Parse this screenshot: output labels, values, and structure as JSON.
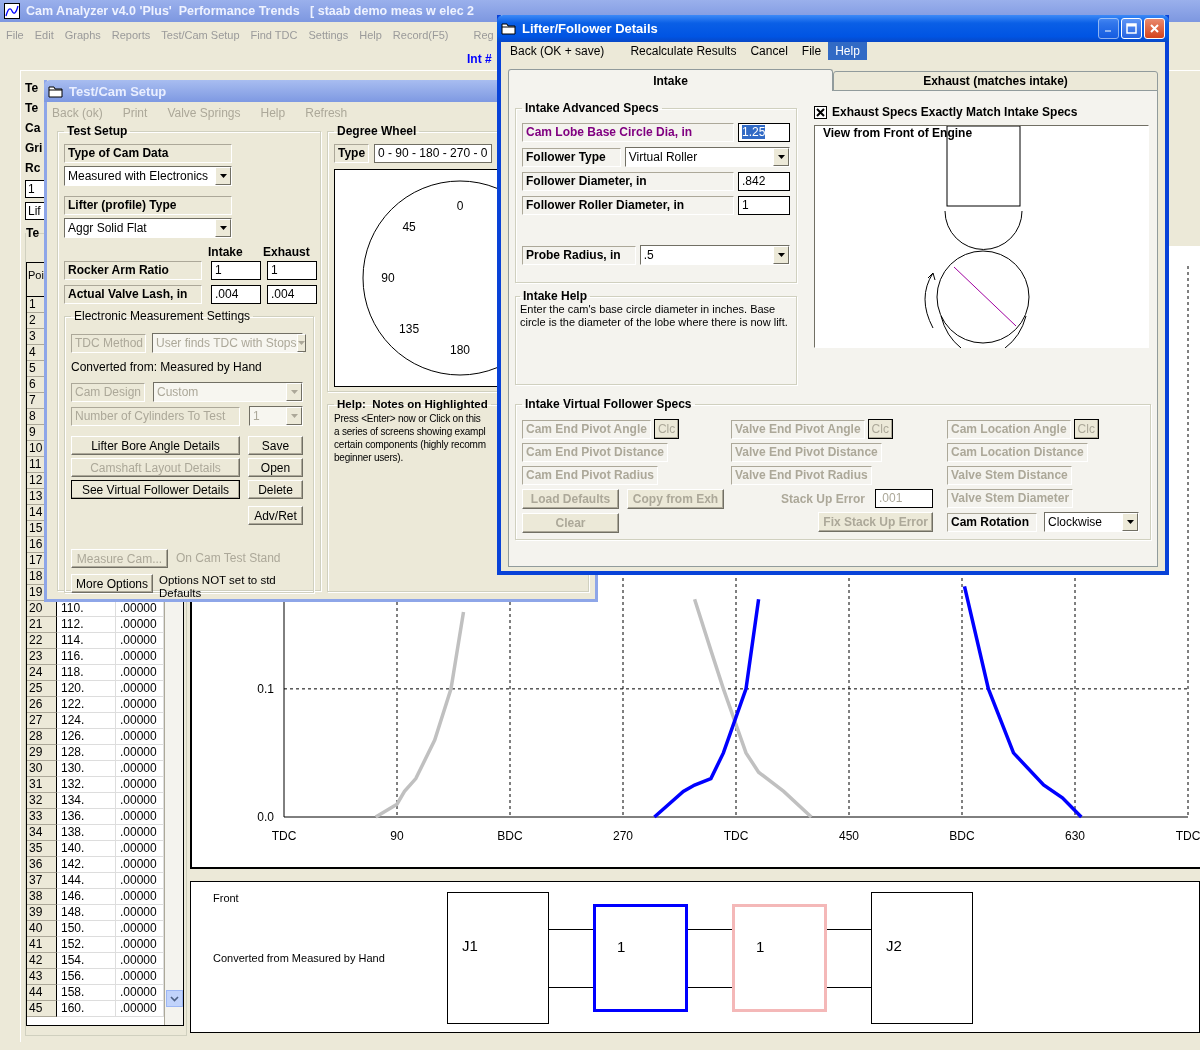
{
  "main": {
    "title": "Cam Analyzer v4.0 'Plus'  Performance Trends   [ staab demo meas w elec 2",
    "menu": [
      "File",
      "Edit",
      "Graphs",
      "Reports",
      "Test/Cam Setup",
      "Find TDC",
      "Settings",
      "Help",
      "Record(F5)",
      "Reg"
    ],
    "int_label": "Int #"
  },
  "left_panel": {
    "fragments": [
      {
        "kind": "label",
        "text": "Te"
      },
      {
        "kind": "label",
        "text": "Te"
      },
      {
        "kind": "label",
        "text": "Ca"
      },
      {
        "kind": "label",
        "text": "Gri"
      },
      {
        "kind": "label",
        "text": "Rc"
      },
      {
        "kind": "input",
        "text": "1"
      },
      {
        "kind": "input",
        "text": "Lif"
      }
    ],
    "table_group": "Te",
    "table": {
      "header": "Poi",
      "rows": [
        {
          "num": "1"
        },
        {
          "num": "2"
        },
        {
          "num": "3"
        },
        {
          "num": "4"
        },
        {
          "num": "5"
        },
        {
          "num": "6"
        },
        {
          "num": "7"
        },
        {
          "num": "8"
        },
        {
          "num": "9"
        },
        {
          "num": "10"
        },
        {
          "num": "11"
        },
        {
          "num": "12"
        },
        {
          "num": "13"
        },
        {
          "num": "14"
        },
        {
          "num": "15"
        },
        {
          "num": "16"
        },
        {
          "num": "17"
        },
        {
          "num": "18"
        },
        {
          "num": "19"
        },
        {
          "num": "20",
          "deg": "110.",
          "lift": ".00000"
        },
        {
          "num": "21",
          "deg": "112.",
          "lift": ".00000"
        },
        {
          "num": "22",
          "deg": "114.",
          "lift": ".00000"
        },
        {
          "num": "23",
          "deg": "116.",
          "lift": ".00000"
        },
        {
          "num": "24",
          "deg": "118.",
          "lift": ".00000"
        },
        {
          "num": "25",
          "deg": "120.",
          "lift": ".00000"
        },
        {
          "num": "26",
          "deg": "122.",
          "lift": ".00000"
        },
        {
          "num": "27",
          "deg": "124.",
          "lift": ".00000"
        },
        {
          "num": "28",
          "deg": "126.",
          "lift": ".00000"
        },
        {
          "num": "29",
          "deg": "128.",
          "lift": ".00000"
        },
        {
          "num": "30",
          "deg": "130.",
          "lift": ".00000"
        },
        {
          "num": "31",
          "deg": "132.",
          "lift": ".00000"
        },
        {
          "num": "32",
          "deg": "134.",
          "lift": ".00000"
        },
        {
          "num": "33",
          "deg": "136.",
          "lift": ".00000"
        },
        {
          "num": "34",
          "deg": "138.",
          "lift": ".00000"
        },
        {
          "num": "35",
          "deg": "140.",
          "lift": ".00000"
        },
        {
          "num": "36",
          "deg": "142.",
          "lift": ".00000"
        },
        {
          "num": "37",
          "deg": "144.",
          "lift": ".00000"
        },
        {
          "num": "38",
          "deg": "146.",
          "lift": ".00000"
        },
        {
          "num": "39",
          "deg": "148.",
          "lift": ".00000"
        },
        {
          "num": "40",
          "deg": "150.",
          "lift": ".00000"
        },
        {
          "num": "41",
          "deg": "152.",
          "lift": ".00000"
        },
        {
          "num": "42",
          "deg": "154.",
          "lift": ".00000"
        },
        {
          "num": "43",
          "deg": "156.",
          "lift": ".00000"
        },
        {
          "num": "44",
          "deg": "158.",
          "lift": ".00000"
        },
        {
          "num": "45",
          "deg": "160.",
          "lift": ".00000"
        }
      ]
    }
  },
  "lift_chart": {
    "chart_data": {
      "type": "line",
      "x": [
        73,
        90,
        96,
        105,
        120,
        133,
        143,
        295,
        318,
        327,
        340,
        350,
        368,
        378,
        398,
        420,
        542,
        561,
        581,
        605,
        620,
        635
      ],
      "series": [
        {
          "color": "#c0c0c0",
          "values": [
            0,
            0.01,
            0.02,
            0.03,
            0.06,
            0.1,
            0.16,
            null,
            null,
            0.17,
            0.13,
            0.1,
            0.05,
            0.035,
            0.02,
            0,
            null,
            null,
            null,
            null,
            null,
            null
          ]
        },
        {
          "color": "#0000ff",
          "values": [
            null,
            null,
            null,
            null,
            null,
            null,
            null,
            0,
            0.02,
            0.025,
            0.03,
            0.05,
            0.1,
            0.17,
            null,
            null,
            0.18,
            0.1,
            0.05,
            0.025,
            0.015,
            0
          ]
        }
      ],
      "grid": true,
      "xlim": [
        0,
        720
      ],
      "ylim": [
        0,
        0.43
      ],
      "xticks": [
        {
          "value": 0,
          "label": "TDC"
        },
        {
          "value": 90,
          "label": "90"
        },
        {
          "value": 180,
          "label": "BDC"
        },
        {
          "value": 270,
          "label": "270"
        },
        {
          "value": 360,
          "label": "TDC"
        },
        {
          "value": 450,
          "label": "450"
        },
        {
          "value": 540,
          "label": "BDC"
        },
        {
          "value": 630,
          "label": "630"
        },
        {
          "value": 720,
          "label": "TDC"
        }
      ],
      "yticks": [
        {
          "value": 0,
          "label": "0.0"
        },
        {
          "value": 0.1,
          "label": "0.1"
        }
      ]
    }
  },
  "layout_diagram": {
    "front": "Front",
    "note": "Converted from Measured by Hand",
    "nodes": [
      {
        "kind": "journal",
        "label": "J1",
        "color": "#000000"
      },
      {
        "kind": "lobe",
        "label": "1",
        "color": "#0000ff"
      },
      {
        "kind": "lobe",
        "label": "1",
        "color": "#f4b8b8"
      },
      {
        "kind": "journal",
        "label": "J2",
        "color": "#000000"
      }
    ]
  },
  "setup": {
    "title": "Test/Cam Setup",
    "menu": [
      {
        "label": "Back (ok)",
        "disabled": true
      },
      {
        "label": "Print",
        "disabled": true
      },
      {
        "label": "Valve Springs",
        "disabled": true
      },
      {
        "label": "Help",
        "disabled": true
      },
      {
        "label": "Refresh",
        "disabled": true
      }
    ],
    "test_setup": {
      "title": "Test Setup",
      "cam_data": {
        "label": "Type of Cam Data",
        "value": "Measured with Electronics"
      },
      "lifter": {
        "label": "Lifter (profile) Type",
        "value": "Aggr Solid Flat"
      },
      "columns": [
        "Intake",
        "Exhaust"
      ],
      "rows": [
        {
          "label": "Rocker Arm Ratio",
          "intake": "1",
          "exhaust": "1"
        },
        {
          "label": "Actual Valve Lash, in",
          "intake": ".004",
          "exhaust": ".004"
        }
      ],
      "electronic": {
        "title": "Electronic Measurement Settings",
        "tdc_method": {
          "label": "TDC Method",
          "value": "User finds TDC with Stops",
          "disabled": true
        },
        "converted": "Converted from: Measured by Hand",
        "cam_design": {
          "label": "Cam Design",
          "value": "Custom",
          "disabled": true
        },
        "cylinders": {
          "label": "Number of Cylinders To Test",
          "value": "1",
          "disabled": true
        },
        "button_rows": [
          [
            {
              "label": "Lifter Bore Angle Details",
              "disabled": false,
              "focused": false
            },
            {
              "label": "Save",
              "disabled": false,
              "focused": false
            }
          ],
          [
            {
              "label": "Camshaft Layout Details",
              "disabled": true,
              "focused": false
            },
            {
              "label": "Open",
              "disabled": false,
              "focused": false
            }
          ],
          [
            {
              "label": "See Virtual Follower Details",
              "disabled": false,
              "focused": true
            },
            {
              "label": "Delete",
              "disabled": false,
              "focused": false
            }
          ],
          [
            {
              "label": "Adv/Ret",
              "disabled": false,
              "focused": false
            }
          ]
        ],
        "measure": {
          "button": "Measure Cam...",
          "note": "On Cam Test Stand",
          "disabled": true
        },
        "options": {
          "button": "More Options",
          "note": "Options NOT set to std Defaults",
          "disabled": false
        }
      }
    },
    "degree_wheel": {
      "title": "Degree Wheel",
      "type_label": "Type",
      "type_value": "0 - 90 - 180 - 270 - 0",
      "marks": [
        "0",
        "45",
        "90",
        "135",
        "180"
      ]
    },
    "help": {
      "title": "Help:  Notes on Highlighted",
      "lines": [
        "Press <Enter> now or Click on this",
        "a series of screens showing exampl",
        "certain components (highly recomm",
        "beginner users)."
      ]
    }
  },
  "follower": {
    "title": "Lifter/Follower Details",
    "menu": [
      {
        "label": "Back (OK + save)",
        "selected": false
      },
      {
        "label": "Recalculate Results",
        "selected": false
      },
      {
        "label": "Cancel",
        "selected": false
      },
      {
        "label": "File",
        "selected": false
      },
      {
        "label": "Help",
        "selected": true
      }
    ],
    "tabs": [
      {
        "label": "Intake",
        "selected": true
      },
      {
        "label": "Exhaust (matches intake)",
        "selected": false
      }
    ],
    "advanced": {
      "title": "Intake Advanced Specs",
      "groups": [
        {
          "rows": [
            {
              "kind": "input",
              "label": "Cam Lobe Base Circle Dia, in",
              "value": "1.25",
              "highlighted": true
            },
            {
              "kind": "select",
              "label": "Follower Type",
              "value": "Virtual Roller",
              "highlighted": false
            },
            {
              "kind": "input",
              "label": "Follower Diameter, in",
              "value": ".842",
              "highlighted": false
            },
            {
              "kind": "input",
              "label": "Follower Roller Diameter, in",
              "value": "1",
              "highlighted": false
            }
          ]
        },
        {
          "rows": [
            {
              "kind": "select",
              "label": "Probe Radius, in",
              "value": ".5",
              "highlighted": false
            }
          ]
        }
      ]
    },
    "help": {
      "title": "Intake Help",
      "text": "Enter the cam's base circle diameter in inches.  Base circle is the diameter of the lobe where there is now lift."
    },
    "match": {
      "label": "Exhaust Specs Exactly Match Intake Specs",
      "checked": true
    },
    "view": {
      "title": "View from Front of Engine"
    },
    "virtual": {
      "title": "Intake Virtual Follower Specs",
      "columns": [
        {
          "items": [
            {
              "kind": "field",
              "label": "Cam End Pivot Angle",
              "disabled": true,
              "button": "Clc"
            },
            {
              "kind": "field",
              "label": "Cam End Pivot Distance",
              "disabled": true
            },
            {
              "kind": "field",
              "label": "Cam End Pivot Radius",
              "disabled": true
            },
            {
              "kind": "buttons",
              "buttons": [
                {
                  "label": "Load Defaults",
                  "disabled": true
                },
                {
                  "label": "Copy from Exh",
                  "disabled": true
                }
              ]
            },
            {
              "kind": "buttons",
              "buttons": [
                {
                  "label": "Clear",
                  "disabled": true
                }
              ]
            }
          ]
        },
        {
          "items": [
            {
              "kind": "field",
              "label": "Valve End Pivot Angle",
              "disabled": true,
              "button": "Clc"
            },
            {
              "kind": "field",
              "label": "Valve End Pivot Distance",
              "disabled": true
            },
            {
              "kind": "field",
              "label": "Valve End Pivot Radius",
              "disabled": true
            },
            {
              "kind": "input",
              "label": "Stack Up Error",
              "value": ".001",
              "disabled": true
            },
            {
              "kind": "buttons",
              "buttons": [
                {
                  "label": "Fix Stack Up Error",
                  "disabled": true
                }
              ]
            }
          ]
        },
        {
          "items": [
            {
              "kind": "field",
              "label": "Cam Location Angle",
              "disabled": true,
              "button": "Clc"
            },
            {
              "kind": "field",
              "label": "Cam Location Distance",
              "disabled": true
            },
            {
              "kind": "field",
              "label": "Valve Stem Distance",
              "disabled": true
            },
            {
              "kind": "field",
              "label": "Valve Stem Diameter",
              "disabled": true
            },
            {
              "kind": "select",
              "label": "Cam Rotation",
              "value": "Clockwise",
              "disabled": false
            }
          ]
        }
      ]
    }
  }
}
